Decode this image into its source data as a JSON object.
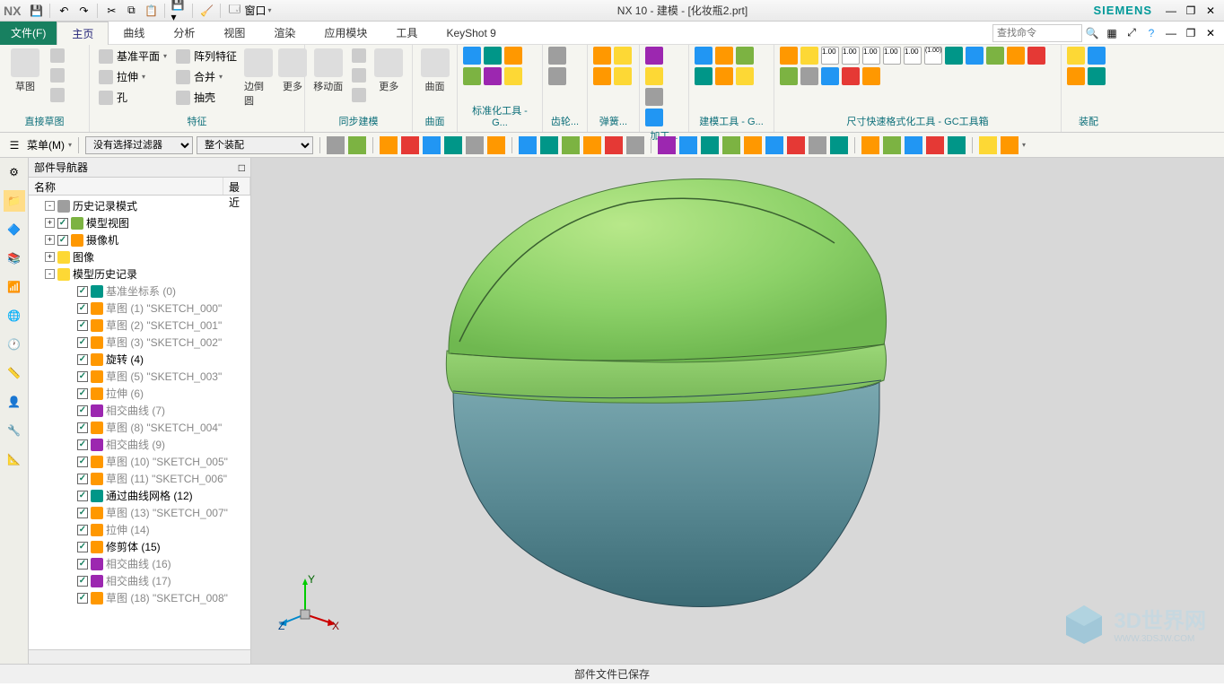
{
  "title": "NX 10 - 建模 - [化妆瓶2.prt]",
  "brand": "SIEMENS",
  "logo": "NX",
  "quickAccess": {
    "window": "窗口"
  },
  "menu": {
    "file": "文件(F)",
    "tabs": [
      "主页",
      "曲线",
      "分析",
      "视图",
      "渲染",
      "应用模块",
      "工具",
      "KeyShot 9"
    ],
    "activeTab": "主页",
    "searchPlaceholder": "查找命令"
  },
  "ribbon": {
    "groups": [
      {
        "label": "直接草图",
        "items": [
          {
            "big": "草图"
          }
        ]
      },
      {
        "label": "特征",
        "items": [
          {
            "sm": [
              "基准平面",
              "拉伸",
              "孔"
            ]
          },
          {
            "sm": [
              "阵列特征",
              "合并",
              "抽壳"
            ]
          },
          {
            "big": "边倒圆"
          },
          {
            "big": "更多"
          }
        ]
      },
      {
        "label": "同步建模",
        "items": [
          {
            "big": "移动面"
          },
          {
            "big": "更多"
          }
        ]
      },
      {
        "label": "曲面",
        "items": [
          {
            "big": "曲面"
          }
        ]
      },
      {
        "label": "标准化工具 - G...",
        "grid": 6
      },
      {
        "label": "齿轮...",
        "grid": 2
      },
      {
        "label": "弹簧...",
        "grid": 4
      },
      {
        "label": "加工...",
        "grid": 4
      },
      {
        "label": "建模工具 - G...",
        "grid": 6
      },
      {
        "label": "尺寸快速格式化工具 - GC工具箱",
        "grid": 14
      },
      {
        "label": "装配",
        "grid": 4
      }
    ]
  },
  "toolbar2": {
    "menuBtn": "菜单(M)",
    "filter1": "没有选择过滤器",
    "filter2": "整个装配"
  },
  "nav": {
    "title": "部件导航器",
    "cols": [
      "名称",
      "最近"
    ],
    "tree": [
      {
        "lvl": 1,
        "exp": "-",
        "icon": "c-grey",
        "label": "历史记录模式"
      },
      {
        "lvl": 1,
        "exp": "+",
        "chk": true,
        "icon": "c-green",
        "label": "模型视图"
      },
      {
        "lvl": 1,
        "exp": "+",
        "chk": true,
        "icon": "c-orange",
        "label": "摄像机"
      },
      {
        "lvl": 1,
        "exp": "+",
        "icon": "c-yellow",
        "label": "图像"
      },
      {
        "lvl": 1,
        "exp": "-",
        "icon": "c-yellow",
        "label": "模型历史记录"
      },
      {
        "lvl": 2,
        "chk": true,
        "icon": "c-teal",
        "label": "基准坐标系 (0)"
      },
      {
        "lvl": 2,
        "chk": true,
        "icon": "c-orange",
        "label": "草图 (1) \"SKETCH_000\""
      },
      {
        "lvl": 2,
        "chk": true,
        "icon": "c-orange",
        "label": "草图 (2) \"SKETCH_001\""
      },
      {
        "lvl": 2,
        "chk": true,
        "icon": "c-orange",
        "label": "草图 (3) \"SKETCH_002\""
      },
      {
        "lvl": 2,
        "chk": true,
        "icon": "c-orange",
        "label": "旋转 (4)"
      },
      {
        "lvl": 2,
        "chk": true,
        "icon": "c-orange",
        "label": "草图 (5) \"SKETCH_003\""
      },
      {
        "lvl": 2,
        "chk": true,
        "icon": "c-orange",
        "label": "拉伸 (6)"
      },
      {
        "lvl": 2,
        "chk": true,
        "icon": "c-purple",
        "label": "相交曲线 (7)"
      },
      {
        "lvl": 2,
        "chk": true,
        "icon": "c-orange",
        "label": "草图 (8) \"SKETCH_004\""
      },
      {
        "lvl": 2,
        "chk": true,
        "icon": "c-purple",
        "label": "相交曲线 (9)"
      },
      {
        "lvl": 2,
        "chk": true,
        "icon": "c-orange",
        "label": "草图 (10) \"SKETCH_005\""
      },
      {
        "lvl": 2,
        "chk": true,
        "icon": "c-orange",
        "label": "草图 (11) \"SKETCH_006\""
      },
      {
        "lvl": 2,
        "chk": true,
        "icon": "c-teal",
        "label": "通过曲线网格 (12)"
      },
      {
        "lvl": 2,
        "chk": true,
        "icon": "c-orange",
        "label": "草图 (13) \"SKETCH_007\""
      },
      {
        "lvl": 2,
        "chk": true,
        "icon": "c-orange",
        "label": "拉伸 (14)"
      },
      {
        "lvl": 2,
        "chk": true,
        "icon": "c-orange",
        "label": "修剪体 (15)"
      },
      {
        "lvl": 2,
        "chk": true,
        "icon": "c-purple",
        "label": "相交曲线 (16)"
      },
      {
        "lvl": 2,
        "chk": true,
        "icon": "c-purple",
        "label": "相交曲线 (17)"
      },
      {
        "lvl": 2,
        "chk": true,
        "icon": "c-orange",
        "label": "草图 (18) \"SKETCH_008\""
      }
    ]
  },
  "status": "部件文件已保存",
  "watermark": {
    "text": "3D世界网",
    "sub": "WWW.3DSJW.COM"
  },
  "axis": {
    "x": "X",
    "y": "Y",
    "z": "Z"
  }
}
